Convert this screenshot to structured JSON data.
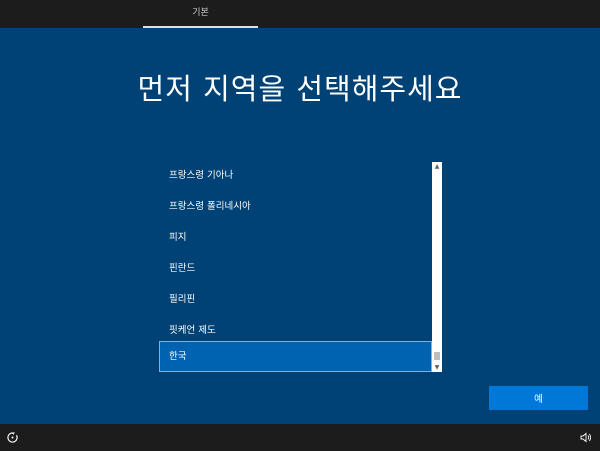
{
  "header": {
    "tab_label": "기본"
  },
  "main": {
    "title": "먼저 지역을 선택해주세요",
    "regions": [
      {
        "label": "프랑스령 기아나",
        "selected": false
      },
      {
        "label": "프랑스령 폴리네시아",
        "selected": false
      },
      {
        "label": "피지",
        "selected": false
      },
      {
        "label": "핀란드",
        "selected": false
      },
      {
        "label": "필리핀",
        "selected": false
      },
      {
        "label": "핏케언 제도",
        "selected": false
      },
      {
        "label": "한국",
        "selected": true
      }
    ],
    "scrollbar": {
      "up_glyph": "▲",
      "down_glyph": "▼"
    },
    "confirm_label": "예"
  },
  "footer": {
    "left_icon": "ease-of-access-icon",
    "right_icon": "volume-icon"
  },
  "colors": {
    "background": "#004275",
    "bar": "#1c1c1c",
    "accent": "#0078d7",
    "selection": "#0063b1"
  }
}
